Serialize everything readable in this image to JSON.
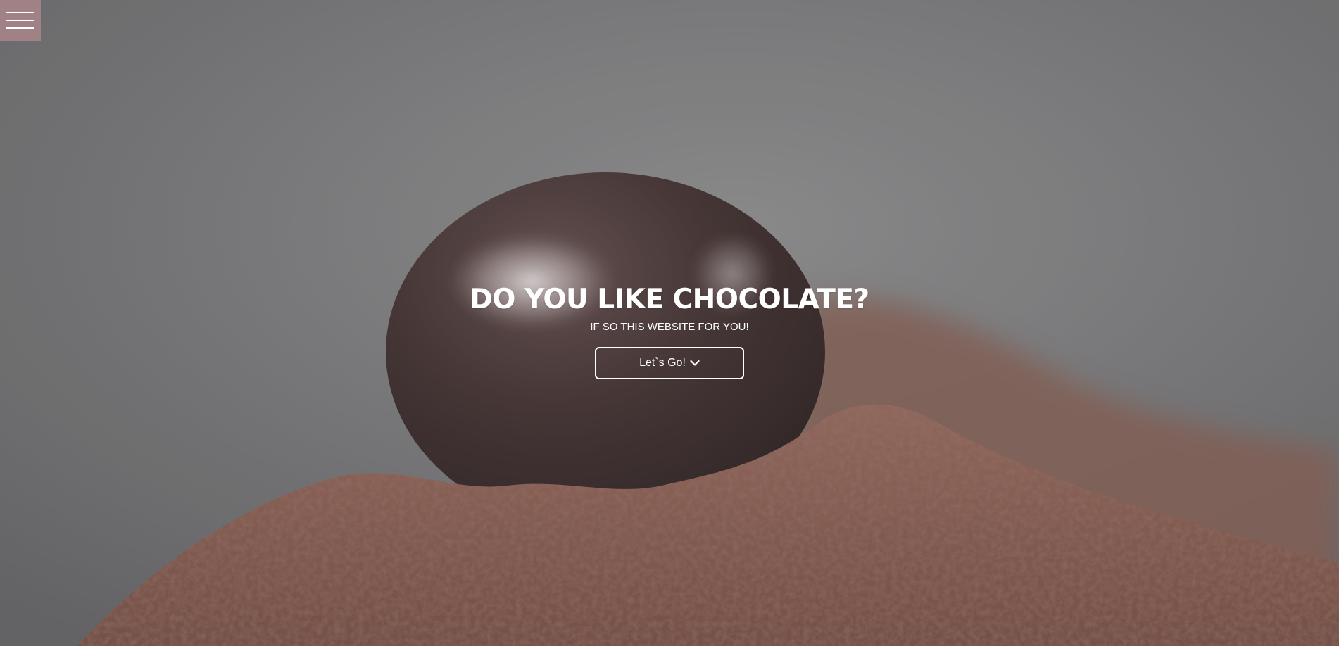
{
  "menu": {
    "icon": "hamburger-menu-icon",
    "color": "#a08185"
  },
  "hero": {
    "background_image": "chocolate-truffle-on-cocoa-powder",
    "title": "DO YOU LIKE CHOCOLATE?",
    "subtitle": "IF SO THIS WEBSITE FOR YOU!",
    "cta_label": "Let`s Go!",
    "cta_icon": "chevron-down-icon"
  },
  "colors": {
    "text": "#ffffff",
    "background": "#6c6c6d",
    "cocoa": "#7a5146",
    "truffle": "#3a2a29"
  }
}
